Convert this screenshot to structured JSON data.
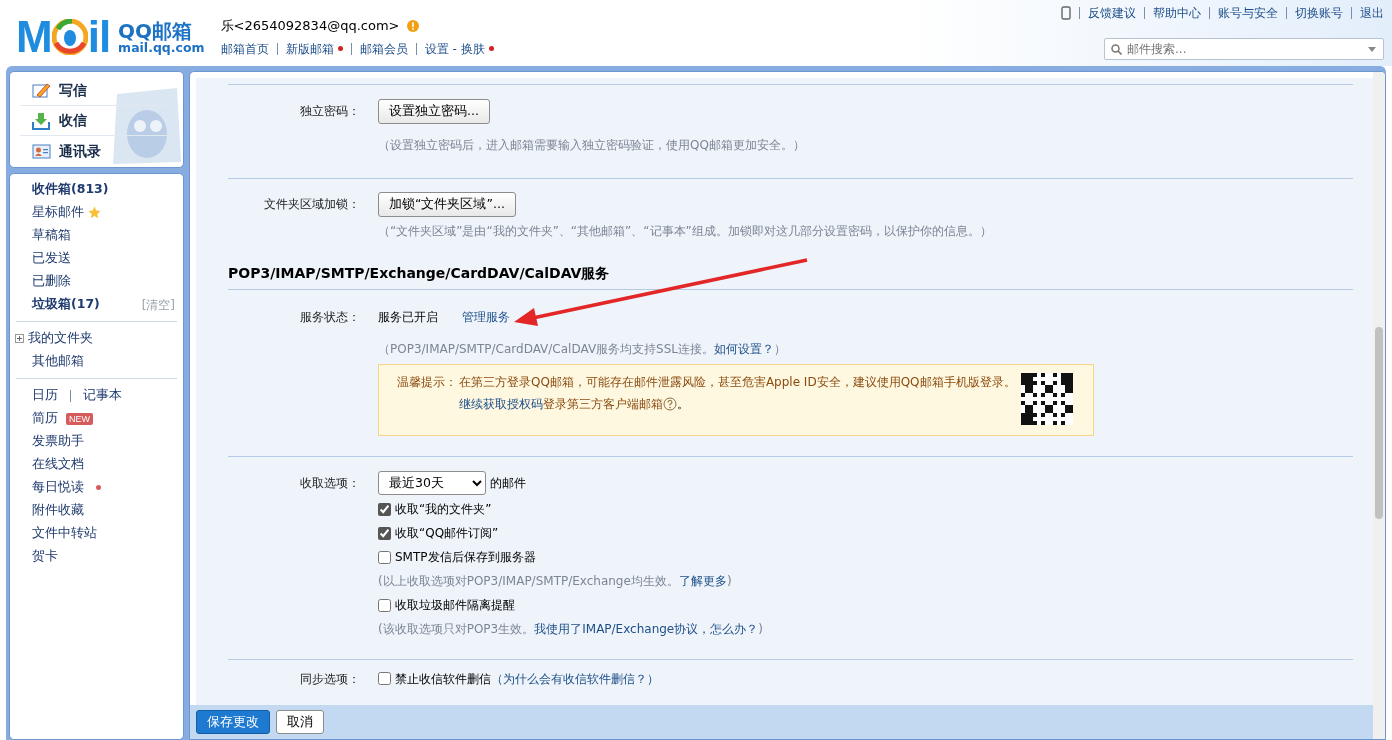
{
  "header": {
    "logo": {
      "left": "M",
      "right": "il",
      "brand": "QQ邮箱",
      "domain": "mail.qq.com"
    },
    "user": "乐<2654092834@qq.com>",
    "nav": [
      {
        "label": "邮箱首页",
        "dot": false
      },
      {
        "label": "新版邮箱",
        "dot": true
      },
      {
        "label": "邮箱会员",
        "dot": false
      },
      {
        "label": "设置 - 换肤",
        "dot": true
      }
    ],
    "top_links": [
      "反馈建议",
      "帮助中心",
      "账号与安全",
      "切换账号",
      "退出"
    ],
    "search": {
      "placeholder": "邮件搜索..."
    }
  },
  "sidebar": {
    "actions": [
      {
        "label": "写信",
        "kind": "compose"
      },
      {
        "label": "收信",
        "kind": "receive"
      },
      {
        "label": "通讯录",
        "kind": "contacts"
      }
    ],
    "groups": [
      [
        {
          "label": "收件箱(813)",
          "kind": "plain",
          "bold": true
        },
        {
          "label": "星标邮件",
          "kind": "starred",
          "bold": false
        },
        {
          "label": "草稿箱",
          "kind": "plain",
          "bold": false
        },
        {
          "label": "已发送",
          "kind": "plain",
          "bold": false
        },
        {
          "label": "已删除",
          "kind": "plain",
          "bold": false
        },
        {
          "label": "垃圾箱(17)",
          "kind": "action",
          "bold": true,
          "action": "[清空]"
        }
      ],
      [
        {
          "label": "我的文件夹",
          "kind": "tree",
          "bold": false,
          "expanded": false
        },
        {
          "label": "其他邮箱",
          "kind": "plain",
          "bold": false
        }
      ],
      [
        {
          "label": "日历",
          "kind": "pair",
          "bold": false,
          "second": "记事本"
        },
        {
          "label": "简历",
          "kind": "badge",
          "bold": false,
          "badge": "NEW"
        },
        {
          "label": "发票助手",
          "kind": "plain",
          "bold": false
        },
        {
          "label": "在线文档",
          "kind": "plain",
          "bold": false
        },
        {
          "label": "每日悦读",
          "kind": "dot",
          "bold": false
        },
        {
          "label": "附件收藏",
          "kind": "plain",
          "bold": false
        },
        {
          "label": "文件中转站",
          "kind": "plain",
          "bold": false
        },
        {
          "label": "贺卡",
          "kind": "plain",
          "bold": false
        }
      ]
    ]
  },
  "settings": {
    "password": {
      "label": "独立密码：",
      "button": "设置独立密码...",
      "note": "（设置独立密码后，进入邮箱需要输入独立密码验证，使用QQ邮箱更加安全。）"
    },
    "folder_lock": {
      "label": "文件夹区域加锁：",
      "button": "加锁“文件夹区域”...",
      "note": "（“文件夹区域”是由“我的文件夹”、“其他邮箱”、“记事本”组成。加锁即对这几部分设置密码，以保护你的信息。）"
    },
    "service_heading": "POP3/IMAP/SMTP/Exchange/CardDAV/CalDAV服务",
    "service": {
      "label": "服务状态：",
      "status": "服务已开启",
      "link": "管理服务",
      "note": {
        "text": "（POP3/IMAP/SMTP/CardDAV/CalDAV服务均支持SSL连接。",
        "link": "如何设置？",
        "tail": "）"
      },
      "tip": {
        "label": "温馨提示：",
        "text": "在第三方登录QQ邮箱，可能存在邮件泄露风险，甚至危害Apple ID安全，建议使用QQ邮箱手机版登录。",
        "link": "继续获取授权码",
        "text2": "登录第三方客户端邮箱",
        "tail": "。"
      }
    },
    "receive": {
      "label": "收取选项：",
      "select": "最近30天",
      "suffix": "的邮件",
      "items": [
        {
          "kind": "checkbox",
          "label": "收取“我的文件夹”",
          "checked": true
        },
        {
          "kind": "checkbox",
          "label": "收取“QQ邮件订阅”",
          "checked": true
        },
        {
          "kind": "checkbox",
          "label": "SMTP发信后保存到服务器",
          "checked": false
        },
        {
          "kind": "note",
          "text": "(以上收取选项对POP3/IMAP/SMTP/Exchange均生效。",
          "link": "了解更多",
          "tail": ")"
        },
        {
          "kind": "checkbox",
          "label": "收取垃圾邮件隔离提醒",
          "checked": false
        },
        {
          "kind": "note",
          "text": "(该收取选项只对POP3生效。",
          "link": "我使用了IMAP/Exchange协议，怎么办？",
          "tail": ")"
        }
      ]
    },
    "sync": {
      "label": "同步选项：",
      "checkbox": "禁止收信软件删信",
      "checked": false,
      "link": "（为什么会有收信软件删信？）"
    }
  },
  "footer": {
    "buttons": [
      {
        "label": "保存更改",
        "kind": "primary"
      },
      {
        "label": "取消",
        "kind": "secondary"
      }
    ]
  }
}
